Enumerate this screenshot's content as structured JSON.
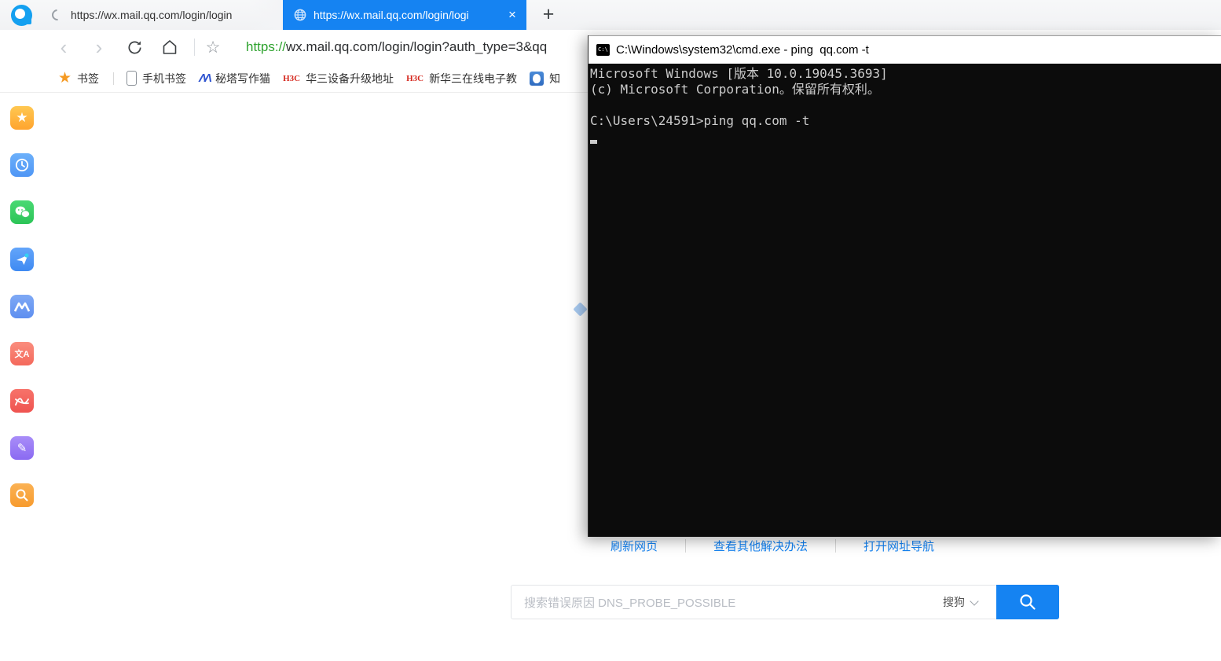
{
  "browser": {
    "logo": "qq-browser-logo",
    "tabs": [
      {
        "title": "https://wx.mail.qq.com/login/login",
        "state": "loading",
        "active": false
      },
      {
        "title": "https://wx.mail.qq.com/login/logi",
        "close_label": "×",
        "active": true
      }
    ],
    "new_tab_label": "+",
    "address_bar": {
      "protocol": "https://",
      "url_rest": "wx.mail.qq.com/login/login?auth_type=3&qq"
    },
    "bookmarks": [
      {
        "icon": "star-icon",
        "label": "书签"
      },
      {
        "icon": "phone-icon",
        "label": "手机书签"
      },
      {
        "icon": "metaso-icon",
        "label": "秘塔写作猫"
      },
      {
        "icon": "h3c-icon",
        "label": "华三设备升级地址"
      },
      {
        "icon": "h3c-icon",
        "label": "新华三在线电子教"
      },
      {
        "icon": "zhihu-icon",
        "label": "知"
      }
    ],
    "h3c_logo_text": "H3C",
    "metaso_logo_text": "ΛΛ",
    "side_dock": [
      "favorites",
      "history",
      "wechat",
      "send-to-phone",
      "mountain-m",
      "translate",
      "pdf-reader",
      "notes",
      "search"
    ],
    "dock_glyphs": {
      "favorites": "★",
      "mountain": "M",
      "translate": "文A",
      "notes": "✎"
    }
  },
  "error_page": {
    "links": [
      {
        "label": "刷新网页"
      },
      {
        "label": "查看其他解决办法"
      },
      {
        "label": "打开网址导航"
      }
    ],
    "search": {
      "placeholder": "搜索错误原因 DNS_PROBE_POSSIBLE",
      "engine": "搜狗"
    }
  },
  "cmd_window": {
    "icon_text": "C:\\",
    "title": "C:\\Windows\\system32\\cmd.exe - ping  qq.com -t",
    "lines": [
      "Microsoft Windows [版本 10.0.19045.3693]",
      "(c) Microsoft Corporation。保留所有权利。",
      "",
      "C:\\Users\\24591>ping qq.com -t"
    ]
  },
  "colors": {
    "accent_blue": "#1583f2",
    "url_https_green": "#2fa32f",
    "terminal_bg": "#0c0c0c",
    "terminal_text": "#cccccc",
    "bookmark_star_orange": "#f59a23",
    "h3c_red": "#d5281e"
  }
}
